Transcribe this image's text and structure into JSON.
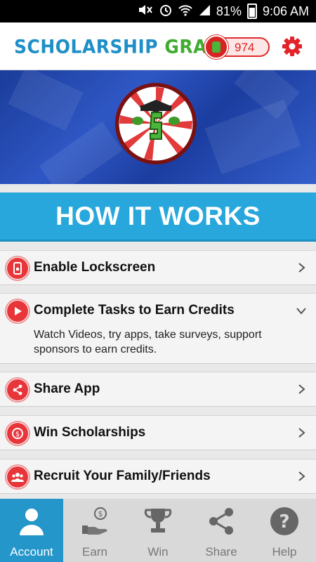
{
  "status_bar": {
    "battery": "81%",
    "time": "9:06 AM"
  },
  "header": {
    "logo_part1": "SCHOLARSHIP",
    "logo_part2": "GRAB",
    "credits": "974"
  },
  "section_title": "HOW IT WORKS",
  "items": [
    {
      "label": "Enable Lockscreen",
      "icon": "phone-lock-icon",
      "state": "collapsed"
    },
    {
      "label": "Complete Tasks to Earn Credits",
      "icon": "play-icon",
      "state": "expanded",
      "description": "Watch Videos, try apps, take surveys, support sponsors to earn credits."
    },
    {
      "label": "Share App",
      "icon": "share-icon",
      "state": "collapsed"
    },
    {
      "label": "Win Scholarships",
      "icon": "coin-icon",
      "state": "collapsed"
    },
    {
      "label": "Recruit Your Family/Friends",
      "icon": "people-icon",
      "state": "collapsed"
    }
  ],
  "nav": {
    "active": "Account",
    "tabs": [
      {
        "label": "Account",
        "icon": "person-icon"
      },
      {
        "label": "Earn",
        "icon": "money-hand-icon"
      },
      {
        "label": "Win",
        "icon": "trophy-icon"
      },
      {
        "label": "Share",
        "icon": "share-icon"
      },
      {
        "label": "Help",
        "icon": "help-icon"
      }
    ]
  },
  "colors": {
    "accent_blue": "#27a7dc",
    "nav_active": "#2496c9",
    "red": "#e8353a",
    "logo_blue": "#1e8fc7",
    "logo_green": "#3fab2f"
  }
}
